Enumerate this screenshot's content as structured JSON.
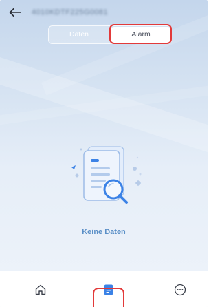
{
  "header": {
    "device_id": "4010KDTF225G0081",
    "back_icon": "arrow-left-icon"
  },
  "tabs": [
    {
      "label": "Daten",
      "selected": false
    },
    {
      "label": "Alarm",
      "selected": true
    }
  ],
  "empty_state": {
    "icon": "document-search-icon",
    "message": "Keine Daten"
  },
  "bottom_nav": [
    {
      "icon": "home-icon",
      "active": false
    },
    {
      "icon": "document-icon",
      "active": true
    },
    {
      "icon": "more-icon",
      "active": false
    }
  ],
  "colors": {
    "accent": "#3b82e6",
    "highlight": "#e23a3a",
    "empty_text": "#5b8fc7"
  }
}
